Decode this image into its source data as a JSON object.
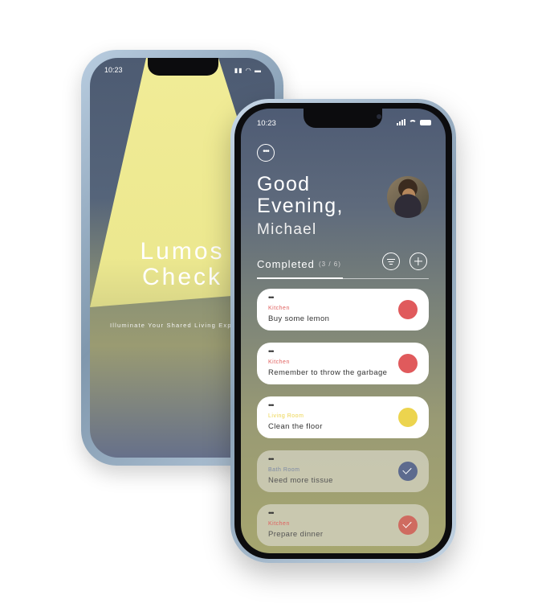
{
  "splash": {
    "time": "10:23",
    "logo_line1": "Lumos",
    "logo_line2": "Check",
    "tagline": "Illuminate Your Shared Living Expe"
  },
  "app": {
    "time": "10:23",
    "greeting_line1": "Good",
    "greeting_line2": "Evening,",
    "user_name": "Michael",
    "section_label": "Completed",
    "count": "(3 / 6)",
    "colors": {
      "kitchen": "#e0605e",
      "living_room": "#ecd44e",
      "bath_room": "#7d8aa5",
      "status_red": "#e05a5c",
      "status_yellow": "#ecd44e",
      "status_blue_done": "#5d6b8e",
      "status_red_done": "#cf6b60"
    },
    "tasks": [
      {
        "category": "Kitchen",
        "title": "Buy some lemon",
        "status": "pending"
      },
      {
        "category": "Kitchen",
        "title": "Remember to throw the garbage",
        "status": "pending"
      },
      {
        "category": "Living Room",
        "title": "Clean the floor",
        "status": "pending"
      },
      {
        "category": "Bath Room",
        "title": "Need more tissue",
        "status": "done"
      },
      {
        "category": "Kitchen",
        "title": "Prepare dinner",
        "status": "done"
      }
    ]
  }
}
